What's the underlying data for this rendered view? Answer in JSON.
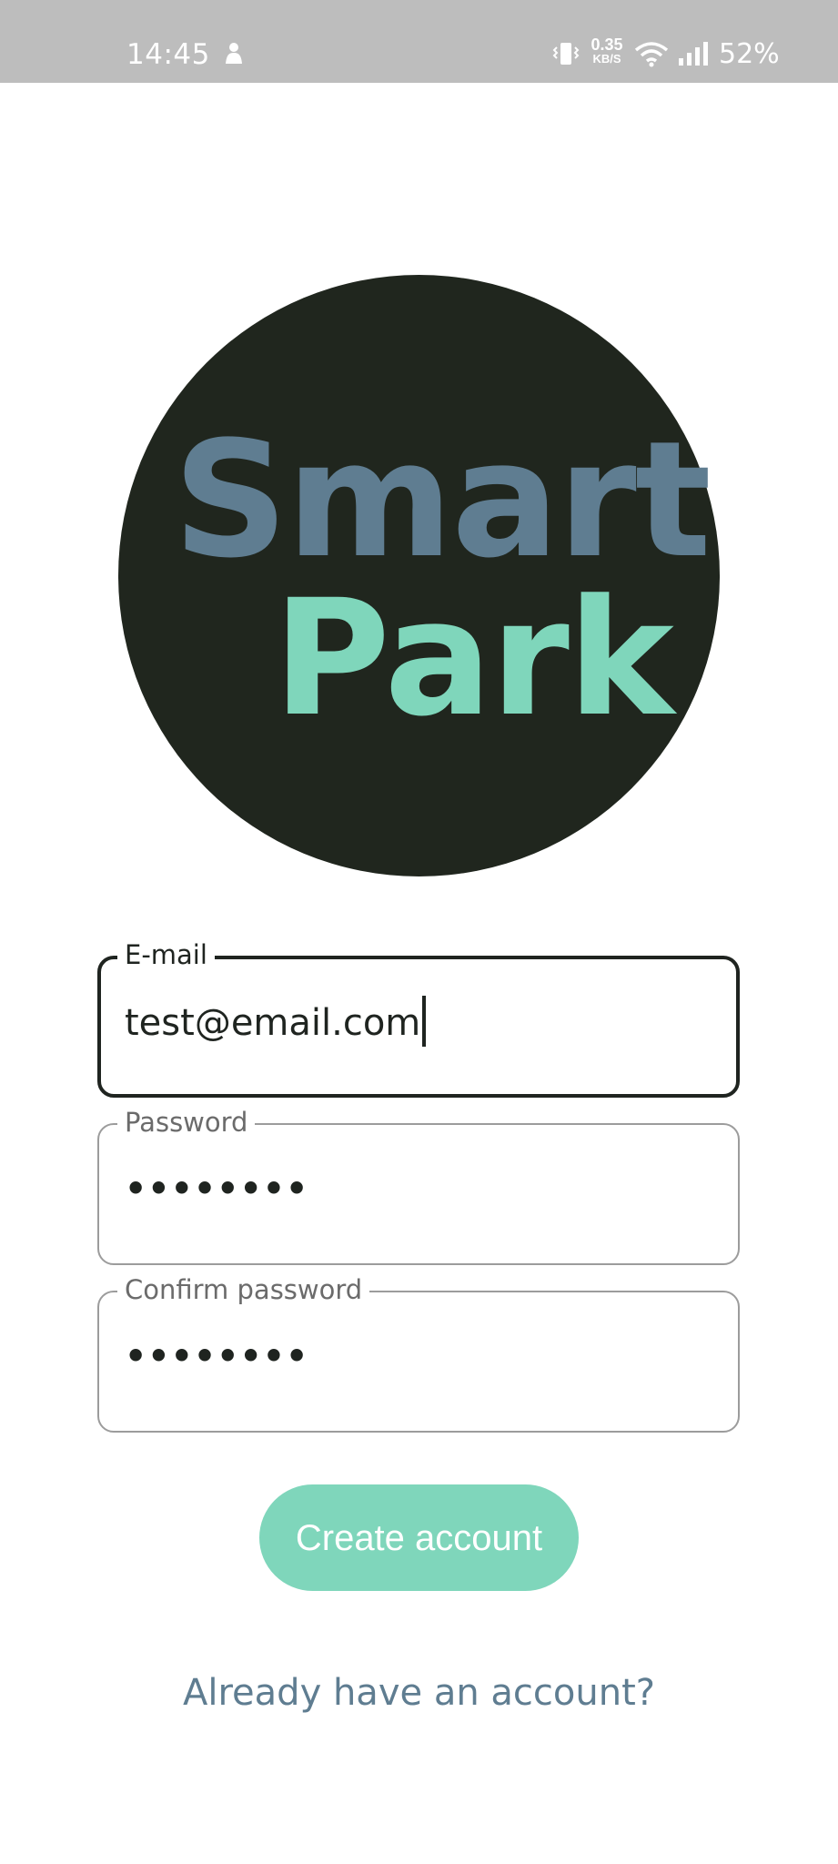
{
  "status_bar": {
    "time": "14:45",
    "net_speed_value": "0.35",
    "net_speed_unit": "KB/S",
    "battery": "52%",
    "icons": [
      "notification-icon",
      "vibrate-icon",
      "wifi-icon",
      "signal-icon"
    ]
  },
  "logo": {
    "line1": "Smart",
    "line2": "Park",
    "colors": {
      "background": "#20261e",
      "smart": "#5f7d91",
      "park": "#7fd6bb"
    }
  },
  "form": {
    "email": {
      "label": "E-mail",
      "value": "test@email.com"
    },
    "password": {
      "label": "Password",
      "value": "••••••••"
    },
    "confirm_password": {
      "label": "Confirm password",
      "value": "••••••••"
    }
  },
  "actions": {
    "create_account": "Create account",
    "login_link": "Already have an account?"
  },
  "colors": {
    "accent": "#7fd6bb",
    "link": "#5f7d91",
    "text": "#1f2420"
  }
}
